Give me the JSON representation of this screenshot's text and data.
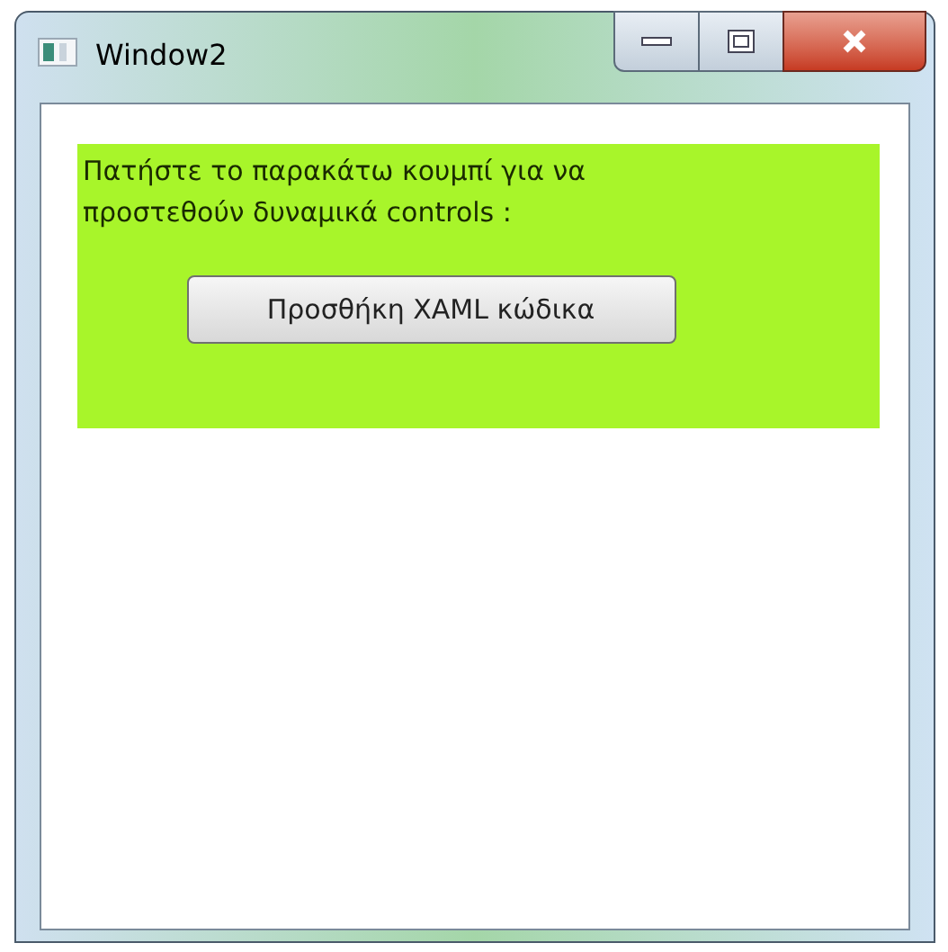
{
  "window": {
    "title": "Window2"
  },
  "panel": {
    "instruction": "Πατήστε το παρακάτω κουμπί για να προστεθούν δυναμικά controls :",
    "button": "Προσθήκη XAML κώδικα"
  }
}
